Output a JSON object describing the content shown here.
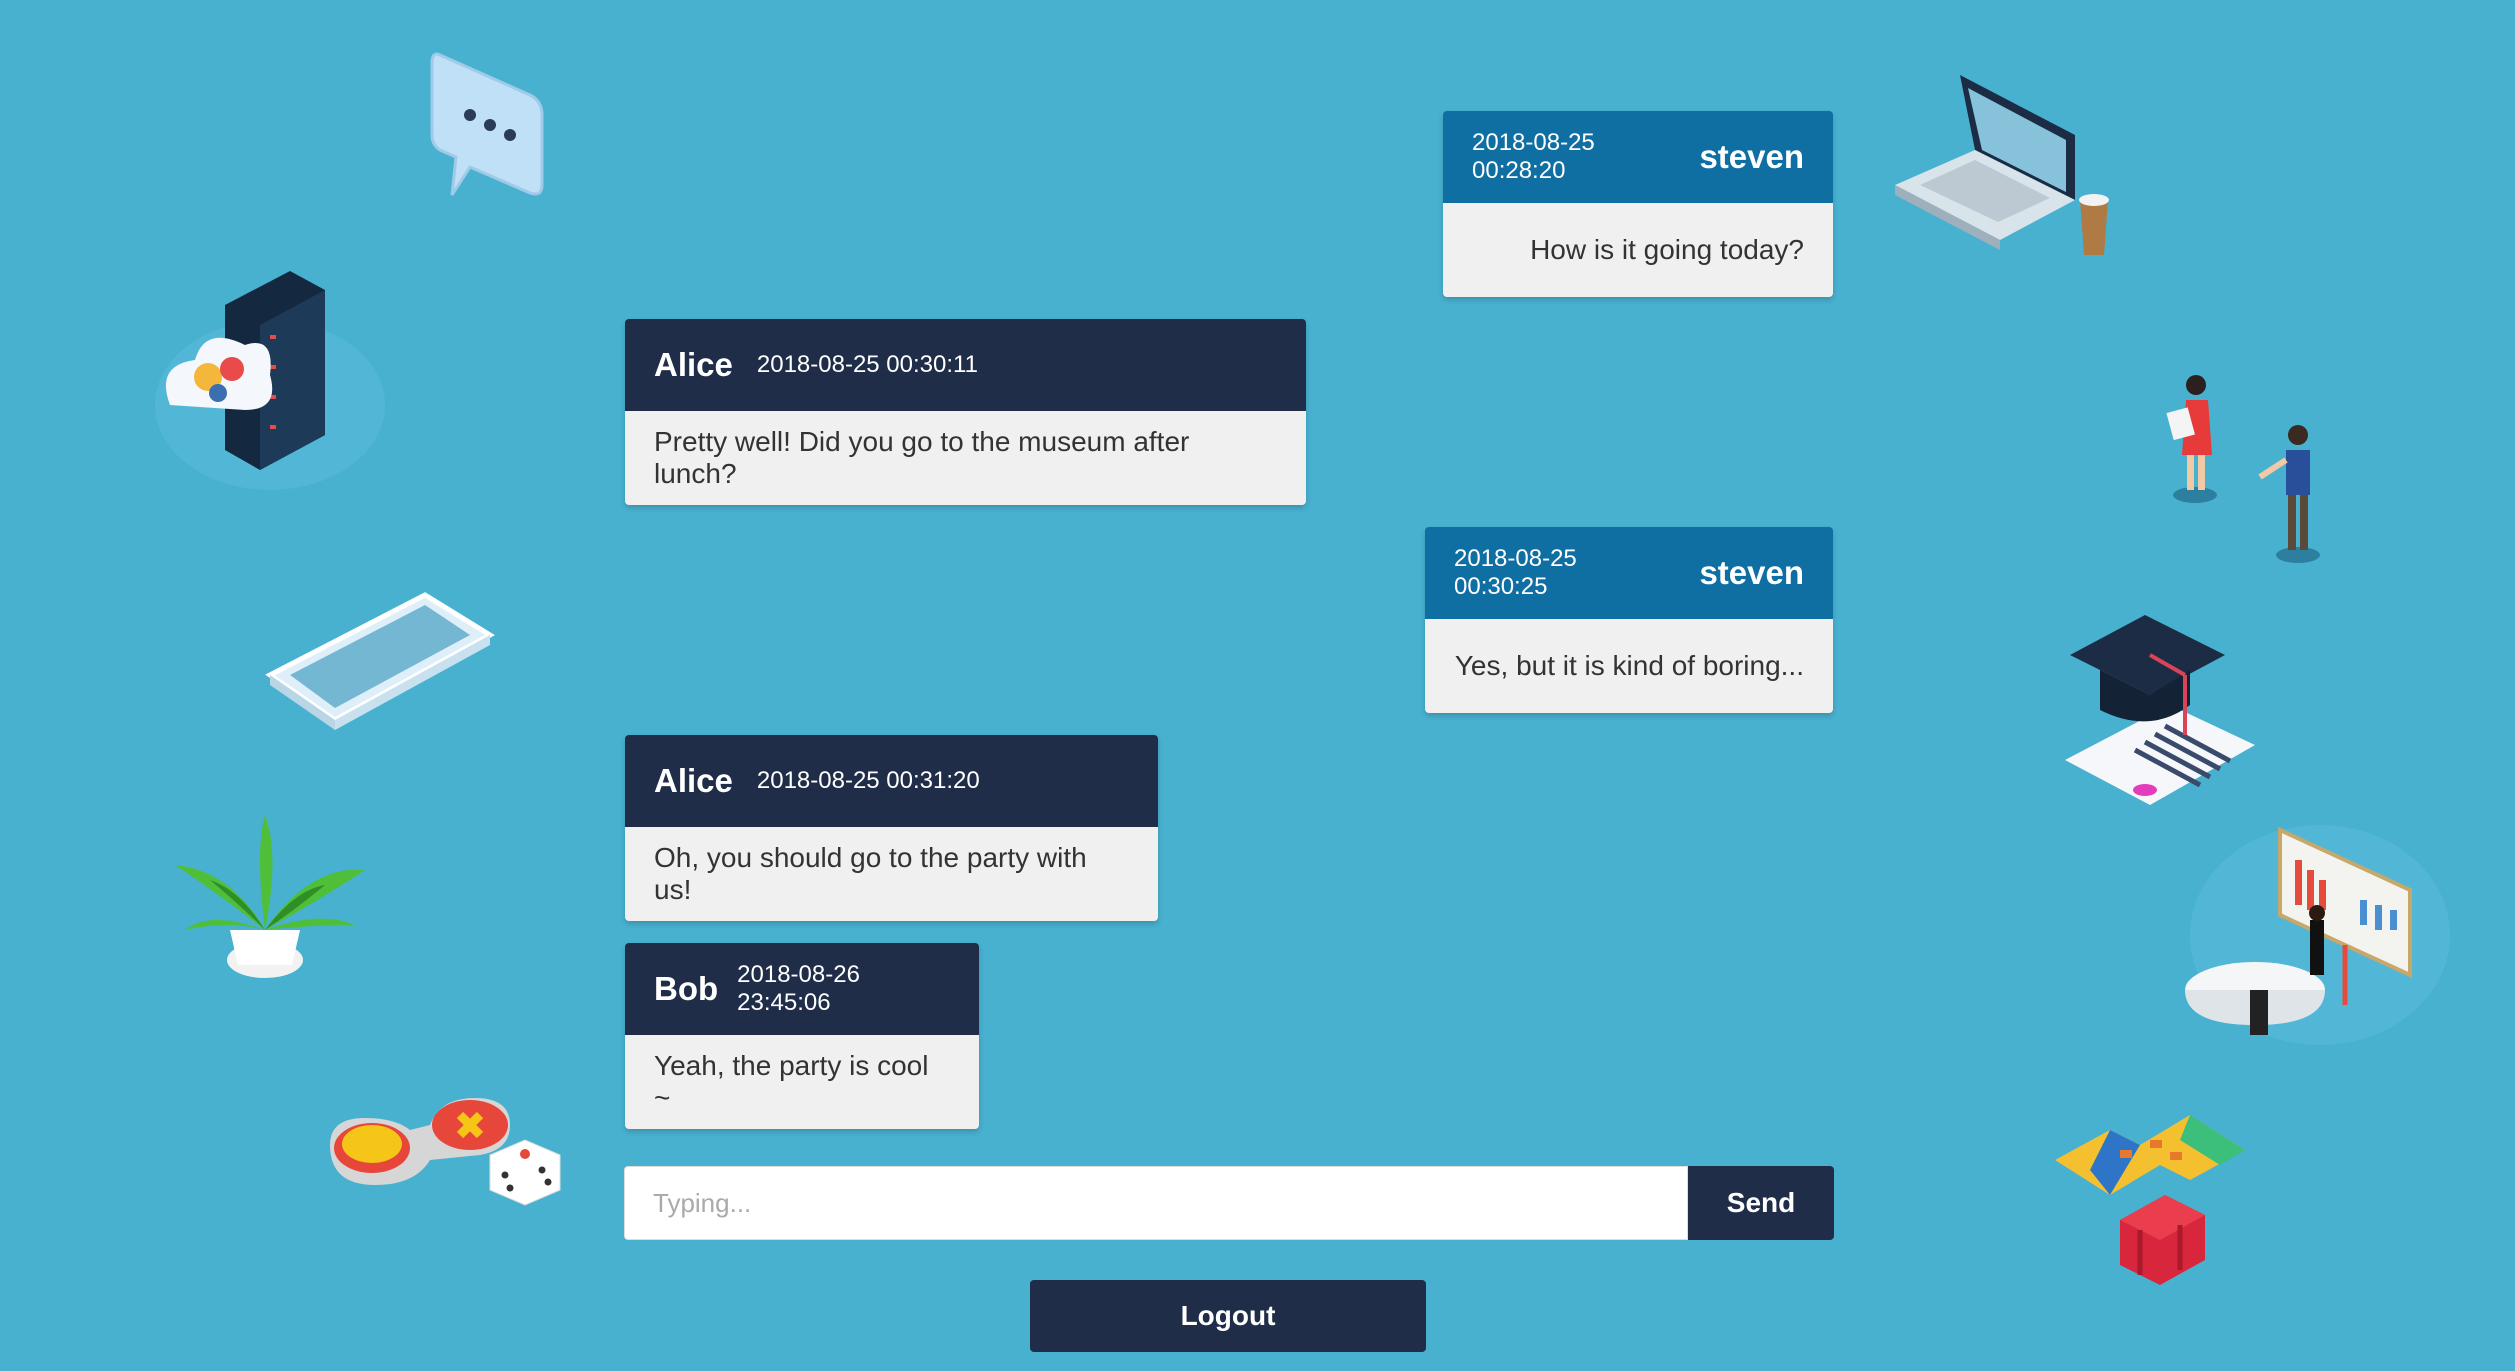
{
  "messages": [
    {
      "side": "right",
      "name": "steven",
      "time": "2018-08-25 00:28:20",
      "text": "How is it going today?"
    },
    {
      "side": "left",
      "name": "Alice",
      "time": "2018-08-25 00:30:11",
      "text": "Pretty well! Did you go to the museum after lunch?"
    },
    {
      "side": "right",
      "name": "steven",
      "time": "2018-08-25 00:30:25",
      "text": "Yes, but it is kind of boring..."
    },
    {
      "side": "left",
      "name": "Alice",
      "time": "2018-08-25 00:31:20",
      "text": "Oh, you should go to the party with us!"
    },
    {
      "side": "left",
      "name": "Bob",
      "time": "2018-08-26 23:45:06",
      "text": "Yeah, the party is cool ~"
    }
  ],
  "composer": {
    "placeholder": "Typing...",
    "send_label": "Send"
  },
  "logout_label": "Logout",
  "colors": {
    "background": "#48b1d0",
    "left_header": "#1f2d49",
    "right_header": "#0f6fa3",
    "body": "#f0f0f0"
  },
  "decorations": [
    "chat-bubble-icon",
    "cloud-server-icon",
    "smartphone-icon",
    "plant-icon",
    "gamepad-dice-icon",
    "laptop-coffee-icon",
    "people-icon",
    "graduation-icon",
    "presentation-icon",
    "map-suitcase-icon"
  ]
}
